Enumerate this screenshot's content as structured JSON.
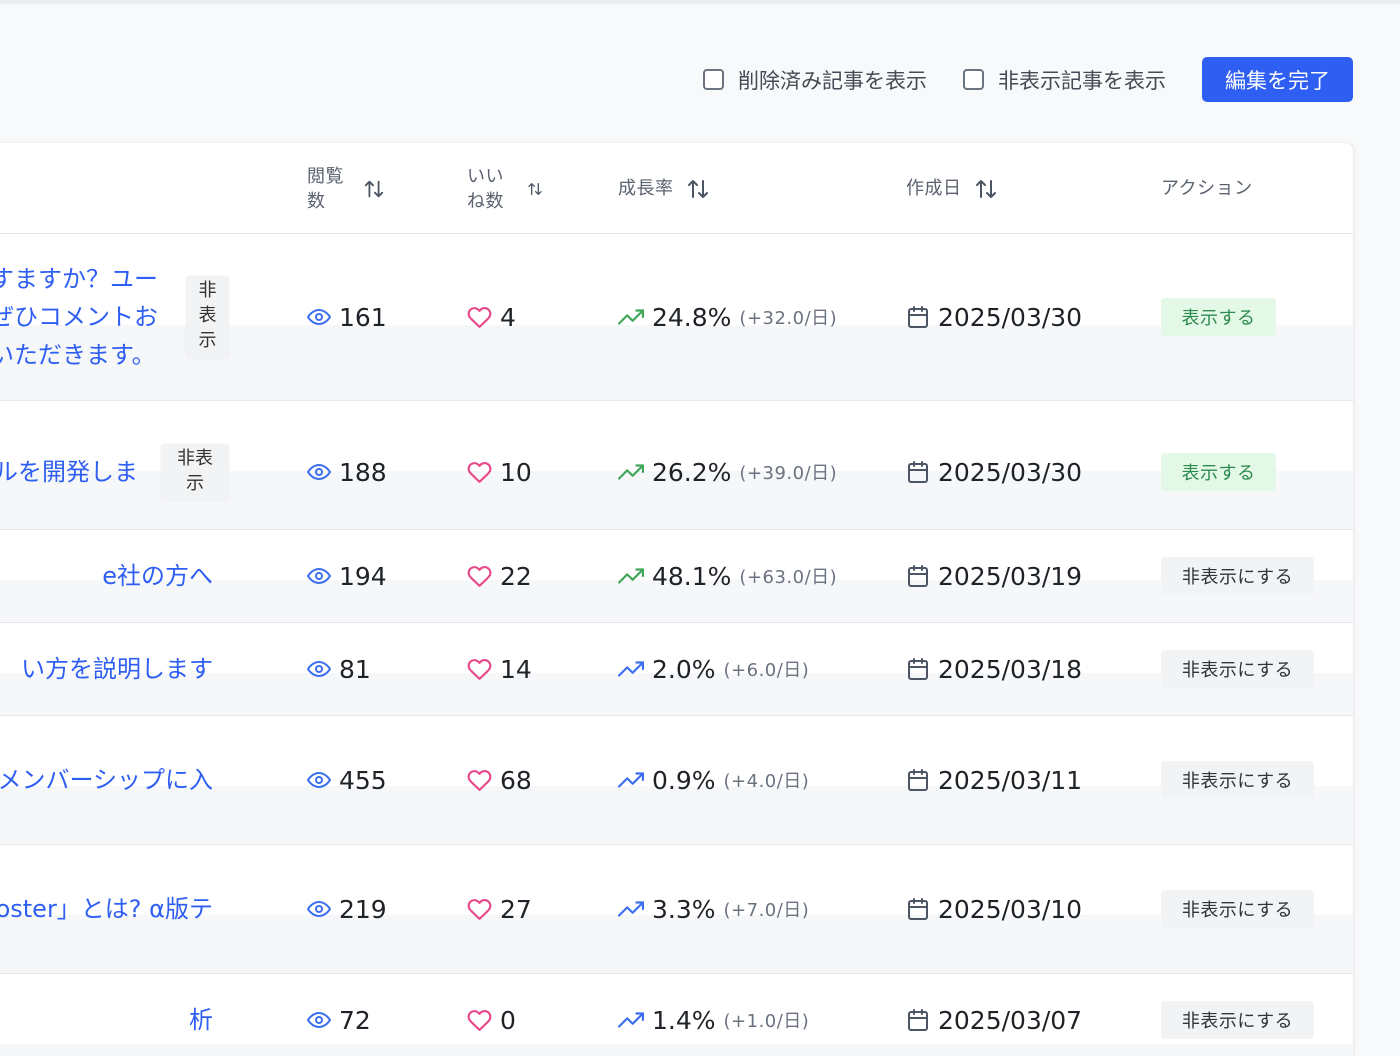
{
  "toolbar": {
    "show_deleted_label": "削除済み記事を表示",
    "show_hidden_label": "非表示記事を表示",
    "done_button_label": "編集を完了"
  },
  "table": {
    "headers": {
      "views": "閲覧数",
      "likes": "いいね数",
      "growth": "成長率",
      "created": "作成日",
      "actions": "アクション"
    },
    "rows": [
      {
        "title": [
          "すますか？ユー",
          "ぜひコメントお",
          "いただきます。"
        ],
        "tag": "非表示",
        "views": "161",
        "likes": "4",
        "growth": "24.8%",
        "growth_detail": "(+32.0/日)",
        "date": "2025/03/30",
        "action": "表示する",
        "hidden": true
      },
      {
        "title": [
          "ルを開発しま"
        ],
        "tag": "非表示",
        "views": "188",
        "likes": "10",
        "growth": "26.2%",
        "growth_detail": "(+39.0/日)",
        "date": "2025/03/30",
        "action": "表示する",
        "hidden": true
      },
      {
        "title": [
          "e社の方へ"
        ],
        "views": "194",
        "likes": "22",
        "growth": "48.1%",
        "growth_detail": "(+63.0/日)",
        "date": "2025/03/19",
        "action": "非表示にする",
        "hidden": false
      },
      {
        "title": [
          "い方を説明します"
        ],
        "views": "81",
        "likes": "14",
        "growth": "2.0%",
        "growth_detail": "(+6.0/日)",
        "date": "2025/03/18",
        "action": "非表示にする",
        "hidden": false
      },
      {
        "title": [
          "メンバーシップに入"
        ],
        "views": "455",
        "likes": "68",
        "growth": "0.9%",
        "growth_detail": "(+4.0/日)",
        "date": "2025/03/11",
        "action": "非表示にする",
        "hidden": false
      },
      {
        "title": [
          "oster」とは? α版テ"
        ],
        "views": "219",
        "likes": "27",
        "growth": "3.3%",
        "growth_detail": "(+7.0/日)",
        "date": "2025/03/10",
        "action": "非表示にする",
        "hidden": false
      },
      {
        "title": [
          "析"
        ],
        "views": "72",
        "likes": "0",
        "growth": "1.4%",
        "growth_detail": "(+1.0/日)",
        "date": "2025/03/07",
        "action": "非表示にする",
        "hidden": false
      }
    ]
  },
  "colors": {
    "accent": "#2f5ff2",
    "view_icon": "#3b6ff0",
    "like_icon": "#e8488a",
    "growth_high": "#3fa65a",
    "growth_low": "#3b6ff0",
    "show_badge_bg": "#e3f8e7"
  },
  "icons": {
    "views": "eye-icon",
    "likes": "heart-icon",
    "growth": "trending-up-icon",
    "date": "calendar-icon",
    "sort": "sort-arrows-icon"
  }
}
